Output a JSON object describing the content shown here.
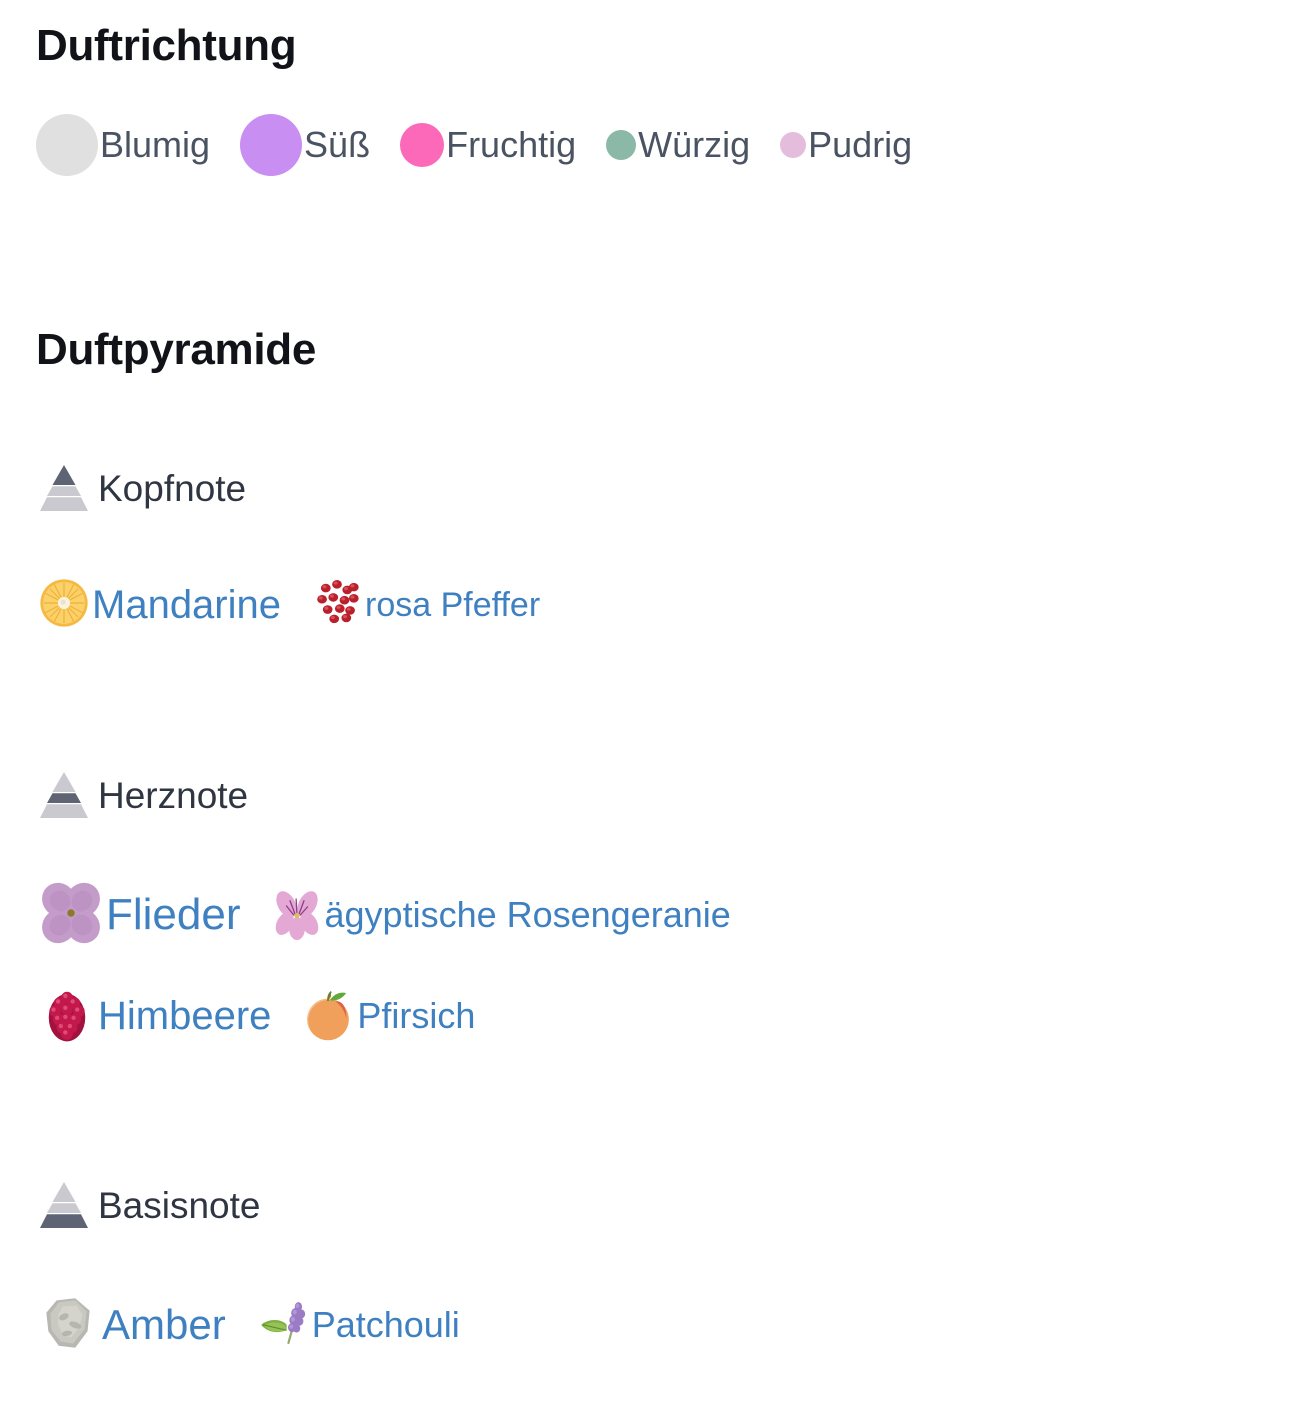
{
  "colors": {
    "background": "#ffffff",
    "heading": "#111318",
    "legend_label": "#4a5362",
    "note_title": "#2f3642",
    "link": "#3f80c0",
    "pyramid_light": "#c9c9cf",
    "pyramid_dark": "#5f6475"
  },
  "scent_direction": {
    "heading": "Duftrichtung",
    "items": [
      {
        "label": "Blumig",
        "color": "#e0e0e0",
        "size": 62,
        "icon": "color-dot-icon"
      },
      {
        "label": "Süß",
        "color": "#c98ef2",
        "size": 62,
        "icon": "color-dot-icon"
      },
      {
        "label": "Fruchtig",
        "color": "#fb69b8",
        "size": 44,
        "icon": "color-dot-icon"
      },
      {
        "label": "Würzig",
        "color": "#8cb8a8",
        "size": 30,
        "icon": "color-dot-icon"
      },
      {
        "label": "Pudrig",
        "color": "#e3bddb",
        "size": 26,
        "icon": "color-dot-icon"
      }
    ]
  },
  "scent_pyramid": {
    "heading": "Duftpyramide",
    "notes": [
      {
        "title": "Kopfnote",
        "icon": "pyramid-top-icon",
        "highlight": "top",
        "rows": [
          [
            {
              "label": "Mandarine",
              "icon": "mandarin-icon",
              "size": 40,
              "icon_size": 56
            },
            {
              "label": "rosa Pfeffer",
              "icon": "pink-pepper-icon",
              "size": 34,
              "icon_size": 56
            }
          ]
        ]
      },
      {
        "title": "Herznote",
        "icon": "pyramid-middle-icon",
        "highlight": "middle",
        "rows": [
          [
            {
              "label": "Flieder",
              "icon": "lilac-flower-icon",
              "size": 44,
              "icon_size": 70
            },
            {
              "label": "ägyptische Rosengeranie",
              "icon": "geranium-flower-icon",
              "size": 36,
              "icon_size": 56
            }
          ],
          [
            {
              "label": "Himbeere",
              "icon": "raspberry-icon",
              "size": 40,
              "icon_size": 62
            },
            {
              "label": "Pfirsich",
              "icon": "peach-icon",
              "size": 36,
              "icon_size": 58
            }
          ]
        ]
      },
      {
        "title": "Basisnote",
        "icon": "pyramid-base-icon",
        "highlight": "base",
        "rows": [
          [
            {
              "label": "Amber",
              "icon": "amber-resin-icon",
              "size": 42,
              "icon_size": 66
            },
            {
              "label": "Patchouli",
              "icon": "patchouli-icon",
              "size": 36,
              "icon_size": 58
            }
          ]
        ]
      }
    ]
  }
}
